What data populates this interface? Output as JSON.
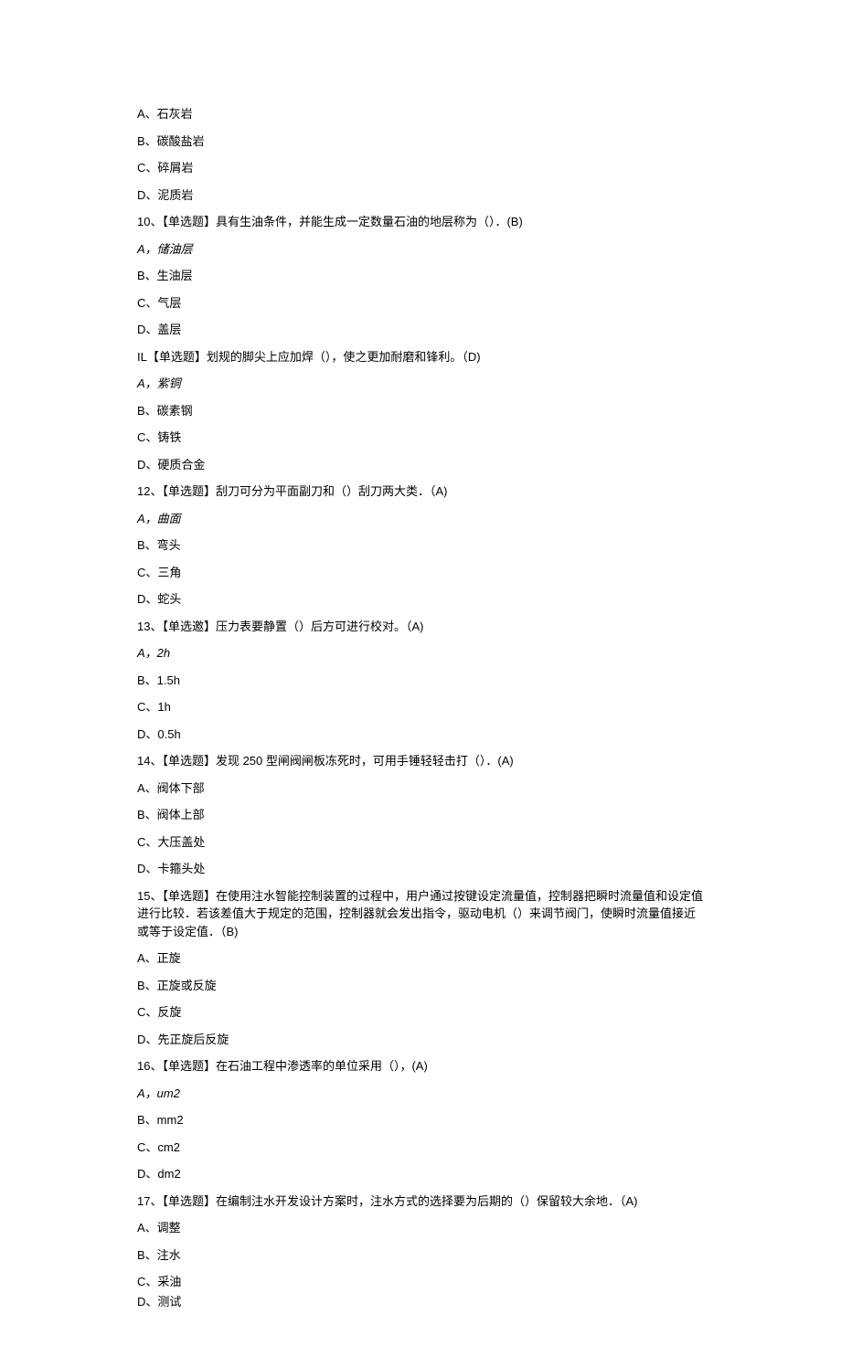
{
  "lines": [
    {
      "text": "A、石灰岩",
      "italic": false
    },
    {
      "text": "B、碳酸盐岩",
      "italic": false
    },
    {
      "text": "C、碎屑岩",
      "italic": false
    },
    {
      "text": "D、泥质岩",
      "italic": false
    },
    {
      "text": "10、【单选题】具有生油条件，并能生成一定数量石油的地层称为（）．(B)",
      "italic": false
    },
    {
      "text": "A，储油层",
      "italic": true
    },
    {
      "text": "B、生油层",
      "italic": false
    },
    {
      "text": "C、气层",
      "italic": false
    },
    {
      "text": "D、盖层",
      "italic": false
    },
    {
      "text": "IL【单选题】划规的脚尖上应加焊（），使之更加耐磨和锋利。（D)",
      "italic": false
    },
    {
      "text": "A，紫铜",
      "italic": true
    },
    {
      "text": "B、碳素钢",
      "italic": false
    },
    {
      "text": "C、铸铁",
      "italic": false
    },
    {
      "text": "D、硬质合金",
      "italic": false
    },
    {
      "text": "12、【单选题】刮刀可分为平面副刀和（）刮刀两大类．（A)",
      "italic": false
    },
    {
      "text": "A，曲面",
      "italic": true
    },
    {
      "text": "B、弯头",
      "italic": false
    },
    {
      "text": "C、三角",
      "italic": false
    },
    {
      "text": "D、蛇头",
      "italic": false
    },
    {
      "text": "13、【单选邀】压力表要静置（）后方可进行校对。（A)",
      "italic": false
    },
    {
      "text": "A，2h",
      "italic": true
    },
    {
      "text": "B、1.5h",
      "italic": false
    },
    {
      "text": "C、1h",
      "italic": false
    },
    {
      "text": "D、0.5h",
      "italic": false
    },
    {
      "text": "14、【单选题】发现 250 型闸阀闸板冻死时，可用手锤轻轻击打（）．(A)",
      "italic": false
    },
    {
      "text": "A、阀体下部",
      "italic": false
    },
    {
      "text": "B、阀体上部",
      "italic": false
    },
    {
      "text": "C、大压盖处",
      "italic": false
    },
    {
      "text": "D、卡箍头处",
      "italic": false
    },
    {
      "text": "15、【单选题】在使用注水智能控制装置的过程中，用户通过按键设定流量值，控制器把瞬时流量值和设定值进行比较．若该差值大于规定的范围，控制器就会发出指令，驱动电机（）来调节阀门，使瞬时流量值接近或等于设定值．（B)",
      "italic": false
    },
    {
      "text": "A、正旋",
      "italic": false
    },
    {
      "text": "B、正旋或反旋",
      "italic": false
    },
    {
      "text": "C、反旋",
      "italic": false
    },
    {
      "text": "D、先正旋后反旋",
      "italic": false
    },
    {
      "text": "16、【单选题】在石油工程中渗透率的单位采用（），(A)",
      "italic": false
    },
    {
      "text": "A，um2",
      "italic": true
    },
    {
      "text": "B、mm2",
      "italic": false
    },
    {
      "text": "C、cm2",
      "italic": false
    },
    {
      "text": "D、dm2",
      "italic": false
    },
    {
      "text": "17、【单选题】在编制注水开发设计方案时，注水方式的选择要为后期的（）保留较大余地．（A)",
      "italic": false
    },
    {
      "text": "A、调整",
      "italic": false
    },
    {
      "text": "B、注水",
      "italic": false
    },
    {
      "text": "C、采油",
      "italic": false
    },
    {
      "text": "D、测试",
      "italic": false
    }
  ]
}
